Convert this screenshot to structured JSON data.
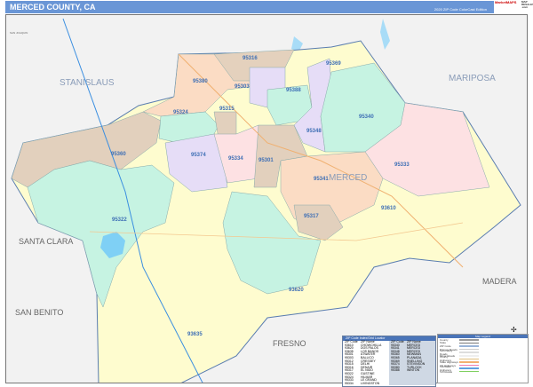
{
  "header": {
    "title": "MERCED COUNTY, CA",
    "subtitle": "2020 ZIP Code ColorCast Edition",
    "logo_text": "MarketMAPS",
    "logo_sub": "MAP RESALES .com"
  },
  "counties": {
    "stanislaus": "STANISLAUS",
    "mariposa": "MARIPOSA",
    "santa_clara": "SANTA CLARA",
    "madera": "MADERA",
    "san_benito": "SAN BENITO",
    "fresno": "FRESNO",
    "merced": "MERCED",
    "san_joaquin": "SAN JOAQUIN"
  },
  "zip_labels": [
    "95316",
    "95369",
    "95380",
    "95303",
    "95388",
    "95324",
    "95315",
    "95340",
    "95348",
    "95374",
    "95334",
    "95301",
    "95341",
    "95360",
    "95333",
    "95317",
    "95322",
    "93610",
    "93620",
    "93635"
  ],
  "zip_index": {
    "title": "ZIP Code Index/Grid Locator",
    "headers": [
      "ZIP Code",
      "ZIP Name"
    ],
    "left": [
      [
        "93610",
        "CHOWCHILLA"
      ],
      [
        "93620",
        "DOS PALOS"
      ],
      [
        "93635",
        "LOS BANOS"
      ],
      [
        "95301",
        "ATWATER"
      ],
      [
        "95303",
        "BALLICO"
      ],
      [
        "95312",
        "CRESSEY"
      ],
      [
        "95315",
        "DELHI"
      ],
      [
        "95316",
        "DENAIR"
      ],
      [
        "95317",
        "EL NIDO"
      ],
      [
        "95322",
        "GUSTINE"
      ],
      [
        "95324",
        "HILMAR"
      ],
      [
        "95333",
        "LE GRAND"
      ],
      [
        "95334",
        "LIVINGSTON"
      ]
    ],
    "right": [
      [
        "95340",
        "MERCED"
      ],
      [
        "95341",
        "MERCED"
      ],
      [
        "95348",
        "MERCED"
      ],
      [
        "95360",
        "NEWMAN"
      ],
      [
        "95365",
        "PLANADA"
      ],
      [
        "95369",
        "SNELLING"
      ],
      [
        "95374",
        "STEVINSON"
      ],
      [
        "95380",
        "TURLOCK"
      ],
      [
        "95388",
        "WINTON"
      ]
    ]
  },
  "legend": {
    "title": "Map Legend",
    "items": [
      {
        "label": "County",
        "color": "#999999"
      },
      {
        "label": "State",
        "color": "#777777"
      },
      {
        "label": "ZIP Code",
        "color": "#9ab4d8"
      },
      {
        "label": "Primary Roads",
        "color": "#cccccc"
      },
      {
        "label": "Secondary Roads",
        "color": "#dddddd"
      },
      {
        "label": "Minor Roads",
        "color": "#eeeeee"
      },
      {
        "label": "County Highways",
        "color": "#e0c080"
      },
      {
        "label": "State Highways",
        "color": "#f3b070"
      },
      {
        "label": "US Highways",
        "color": "#f080b0"
      },
      {
        "label": "Interstate Highways",
        "color": "#60a0e0"
      },
      {
        "label": "Toll Roads",
        "color": "#80d060"
      }
    ]
  }
}
